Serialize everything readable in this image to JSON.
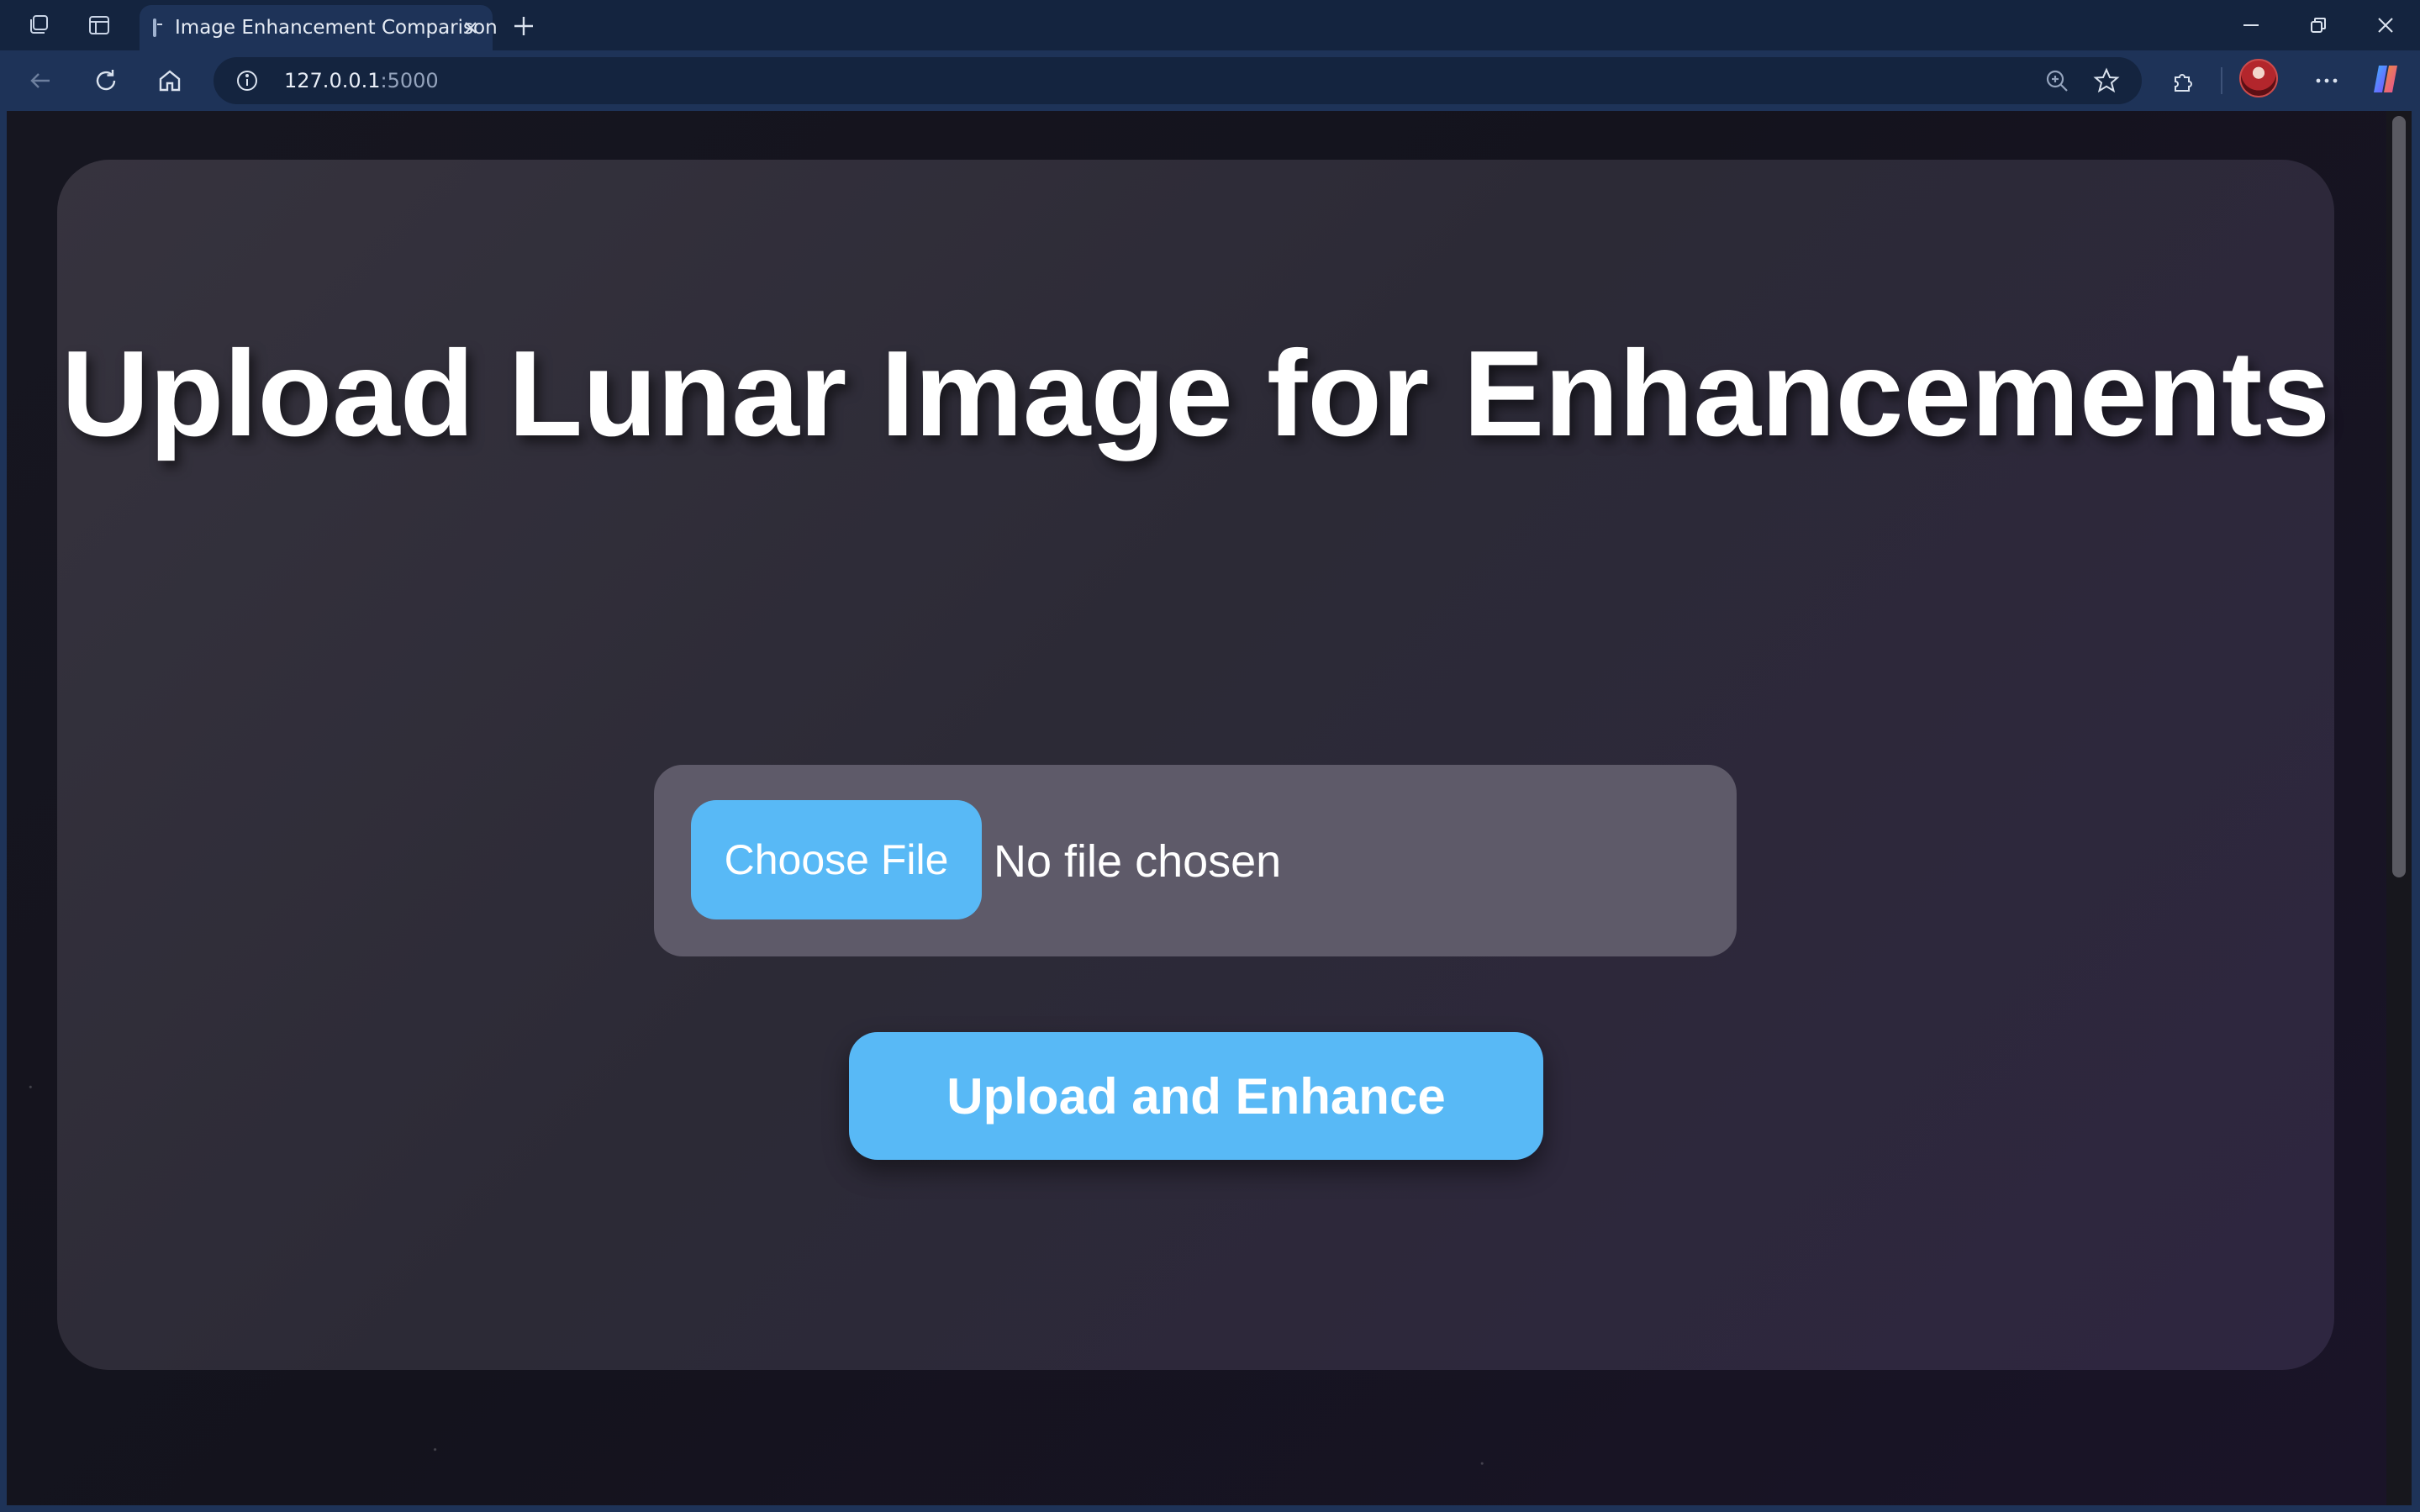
{
  "browser": {
    "tab": {
      "title": "Image Enhancement Comparison"
    },
    "address": {
      "host": "127.0.0.1",
      "port": ":5000"
    },
    "icons": {
      "workspaces": "workspaces-icon",
      "tab_actions": "tab-actions-icon",
      "favicon": "terminal-favicon-icon",
      "tab_close": "close-icon",
      "new_tab": "plus-icon",
      "minimize": "minimize-icon",
      "restore": "restore-icon",
      "close_window": "close-icon",
      "back": "arrow-left-icon",
      "refresh": "refresh-icon",
      "home": "home-icon",
      "site_info": "info-icon",
      "zoom": "zoom-icon",
      "favorite": "star-icon",
      "extensions": "puzzle-icon",
      "profile": "avatar",
      "more": "more-icon",
      "copilot": "copilot-icon"
    },
    "colors": {
      "titlebar": "#14243f",
      "toolbar": "#1e3358"
    }
  },
  "page": {
    "heading": "Upload Lunar Image for Enhancements",
    "file_input": {
      "button_label": "Choose File",
      "status": "No file chosen"
    },
    "submit_label": "Upload and Enhance",
    "colors": {
      "accent": "#58b9f6",
      "card": "#2e2b38",
      "file_box": "#5e5a69"
    }
  }
}
